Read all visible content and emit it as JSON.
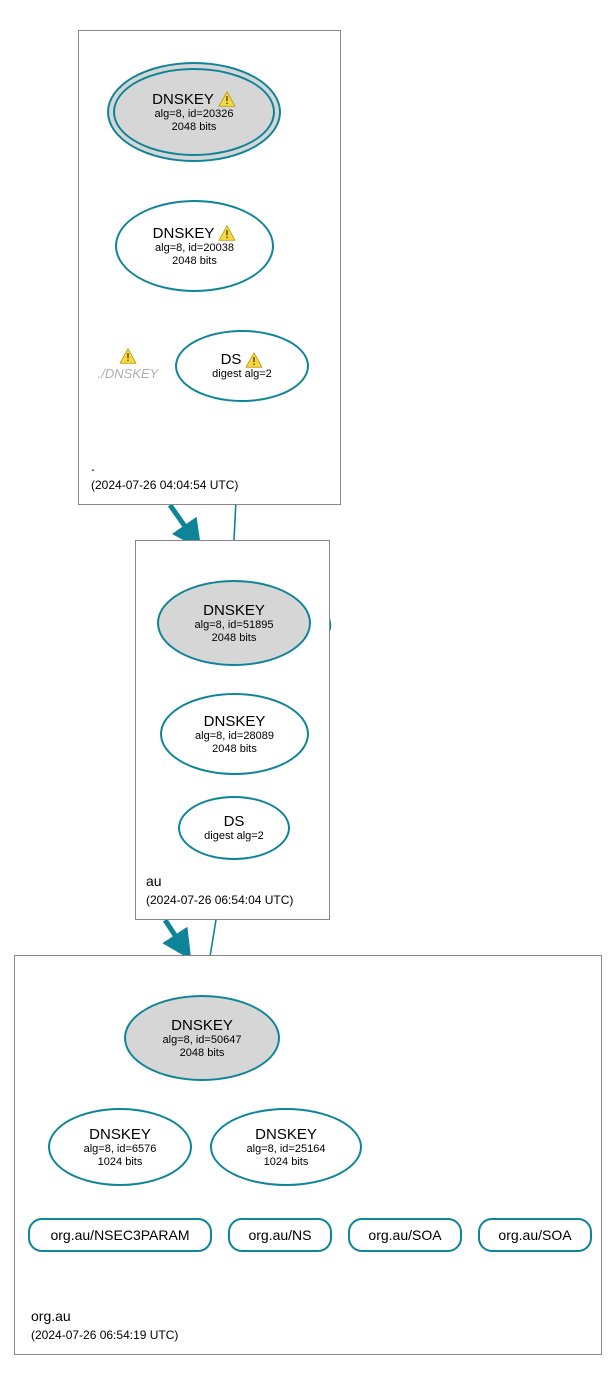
{
  "colors": {
    "accent": "#0e8499",
    "ksk_fill": "#d6d6d6"
  },
  "clusters": {
    "root": {
      "label": ".",
      "timestamp": "(2024-07-26 04:04:54 UTC)"
    },
    "au": {
      "label": "au",
      "timestamp": "(2024-07-26 06:54:04 UTC)"
    },
    "orgau": {
      "label": "org.au",
      "timestamp": "(2024-07-26 06:54:19 UTC)"
    }
  },
  "nodes": {
    "root_ksk": {
      "title": "DNSKEY",
      "warn": true,
      "line1": "alg=8, id=20326",
      "line2": "2048 bits"
    },
    "root_zsk": {
      "title": "DNSKEY",
      "warn": true,
      "line1": "alg=8, id=20038",
      "line2": "2048 bits"
    },
    "root_ds": {
      "title": "DS",
      "warn": true,
      "line1": "digest alg=2",
      "line2": ""
    },
    "root_ghost": {
      "title": "./DNSKEY"
    },
    "au_ksk": {
      "title": "DNSKEY",
      "warn": false,
      "line1": "alg=8, id=51895",
      "line2": "2048 bits"
    },
    "au_zsk": {
      "title": "DNSKEY",
      "warn": false,
      "line1": "alg=8, id=28089",
      "line2": "2048 bits"
    },
    "au_ds": {
      "title": "DS",
      "warn": false,
      "line1": "digest alg=2",
      "line2": ""
    },
    "orgau_ksk": {
      "title": "DNSKEY",
      "warn": false,
      "line1": "alg=8, id=50647",
      "line2": "2048 bits"
    },
    "orgau_zsk1": {
      "title": "DNSKEY",
      "warn": false,
      "line1": "alg=8, id=6576",
      "line2": "1024 bits"
    },
    "orgau_zsk2": {
      "title": "DNSKEY",
      "warn": false,
      "line1": "alg=8, id=25164",
      "line2": "1024 bits"
    },
    "rr_nsec3": {
      "label": "org.au/NSEC3PARAM"
    },
    "rr_ns": {
      "label": "org.au/NS"
    },
    "rr_soa1": {
      "label": "org.au/SOA"
    },
    "rr_soa2": {
      "label": "org.au/SOA"
    }
  }
}
